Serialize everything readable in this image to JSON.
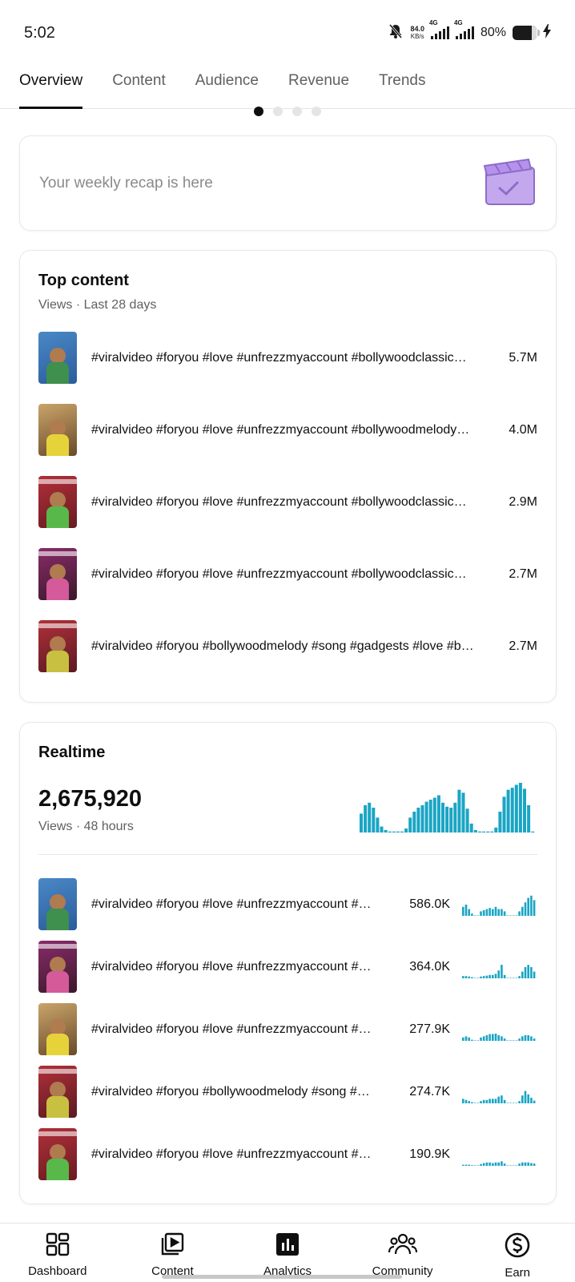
{
  "status": {
    "time": "5:02",
    "speed_top": "84.0",
    "speed_bottom": "KB/s",
    "net1": "4G",
    "net2": "4G",
    "battery": "80%"
  },
  "tabs": [
    {
      "label": "Overview",
      "active": true
    },
    {
      "label": "Content",
      "active": false
    },
    {
      "label": "Audience",
      "active": false
    },
    {
      "label": "Revenue",
      "active": false
    },
    {
      "label": "Trends",
      "active": false
    }
  ],
  "carousel": {
    "active_index": 0,
    "count": 4
  },
  "recap": {
    "text": "Your weekly recap is here",
    "icon": "recap-clapper-icon"
  },
  "top_content": {
    "title": "Top content",
    "subtitle": "Views · Last 28 days",
    "items": [
      {
        "title": "#viralvideo #foryou #love #unfrezzmyaccount #bollywoodclassic…",
        "value": "5.7M"
      },
      {
        "title": "#viralvideo #foryou #love #unfrezzmyaccount #bollywoodmelody…",
        "value": "4.0M"
      },
      {
        "title": "#viralvideo #foryou #love #unfrezzmyaccount #bollywoodclassic…",
        "value": "2.9M"
      },
      {
        "title": "#viralvideo #foryou #love #unfrezzmyaccount #bollywoodclassic…",
        "value": "2.7M"
      },
      {
        "title": "#viralvideo #foryou #bollywoodmelody #song #gadgests #love #b…",
        "value": "2.7M"
      }
    ]
  },
  "realtime": {
    "title": "Realtime",
    "total": "2,675,920",
    "subtitle": "Views · 48 hours",
    "accent": "#1aa5c4",
    "items": [
      {
        "title": "#viralvideo #foryou #love #unfrezzmyaccount #…",
        "value": "586.0K"
      },
      {
        "title": "#viralvideo #foryou #love #unfrezzmyaccount #…",
        "value": "364.0K"
      },
      {
        "title": "#viralvideo #foryou #love #unfrezzmyaccount #…",
        "value": "277.9K"
      },
      {
        "title": "#viralvideo #foryou #bollywoodmelody #song #…",
        "value": "274.7K"
      },
      {
        "title": "#viralvideo #foryou #love #unfrezzmyaccount #…",
        "value": "190.9K"
      }
    ]
  },
  "bottom_nav": [
    {
      "label": "Dashboard",
      "icon": "dashboard-icon"
    },
    {
      "label": "Content",
      "icon": "content-icon"
    },
    {
      "label": "Analytics",
      "icon": "analytics-icon",
      "active": true
    },
    {
      "label": "Community",
      "icon": "community-icon"
    },
    {
      "label": "Earn",
      "icon": "earn-icon"
    }
  ]
}
